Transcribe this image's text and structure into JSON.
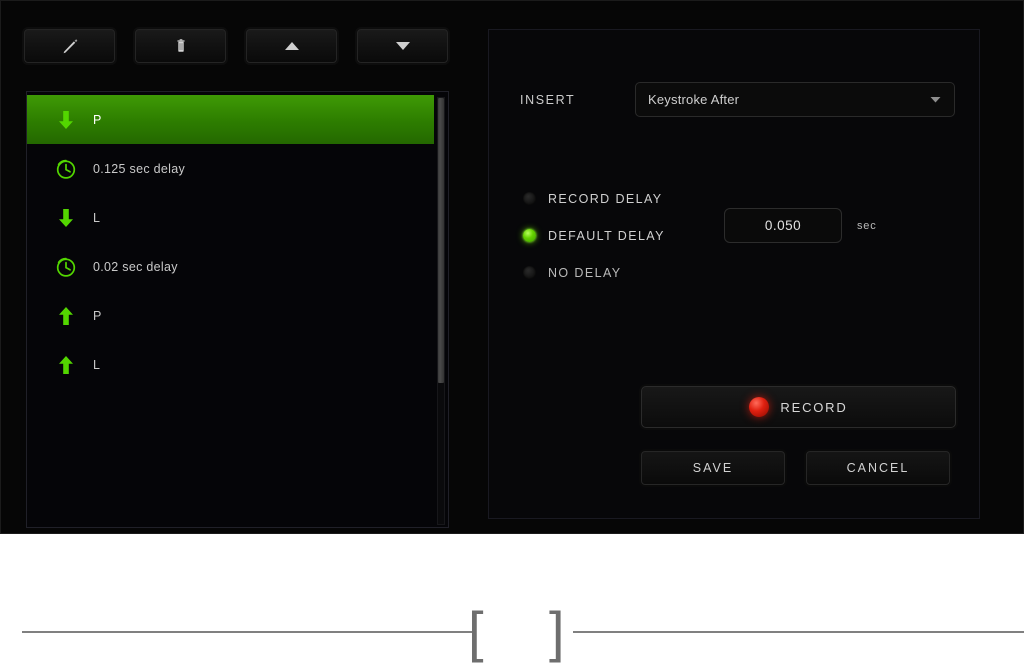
{
  "colors": {
    "accent_green": "#2d7d00",
    "icon_green": "#53d600",
    "record_red": "#e02010",
    "panel_bg": "#060606",
    "text": "#cccccc"
  },
  "toolbar": {
    "buttons": [
      {
        "name": "edit",
        "icon": "pencil-icon",
        "label": "Edit"
      },
      {
        "name": "delete",
        "icon": "trash-icon",
        "label": "Delete"
      },
      {
        "name": "move-up",
        "icon": "triangle-up-icon",
        "label": "Move Up"
      },
      {
        "name": "move-down",
        "icon": "triangle-down-icon",
        "label": "Move Down"
      }
    ]
  },
  "macro_list": {
    "rows": [
      {
        "icon": "arrow-down-icon",
        "type": "key-down",
        "label": "P",
        "selected": true
      },
      {
        "icon": "clock-icon",
        "type": "delay",
        "label": "0.125 sec delay",
        "selected": false
      },
      {
        "icon": "arrow-down-icon",
        "type": "key-down",
        "label": "L",
        "selected": false
      },
      {
        "icon": "clock-icon",
        "type": "delay",
        "label": "0.02 sec delay",
        "selected": false
      },
      {
        "icon": "arrow-up-icon",
        "type": "key-up",
        "label": "P",
        "selected": false
      },
      {
        "icon": "arrow-up-icon",
        "type": "key-up",
        "label": "L",
        "selected": false
      }
    ]
  },
  "insert": {
    "label": "INSERT",
    "selected_value": "Keystroke After",
    "caret_icon": "chevron-down-icon"
  },
  "delay": {
    "options": [
      {
        "label": "RECORD DELAY",
        "selected": false
      },
      {
        "label": "DEFAULT DELAY",
        "selected": true
      },
      {
        "label": "NO DELAY",
        "selected": false
      }
    ],
    "value": "0.050",
    "placeholder": "0.050",
    "unit": "sec"
  },
  "actions": {
    "record_label": "RECORD",
    "record_icon": "record-dot-icon",
    "save_label": "SAVE",
    "cancel_label": "CANCEL"
  },
  "footer": {
    "bracket_open": "[",
    "bracket_close": "]",
    "page_number": ""
  }
}
